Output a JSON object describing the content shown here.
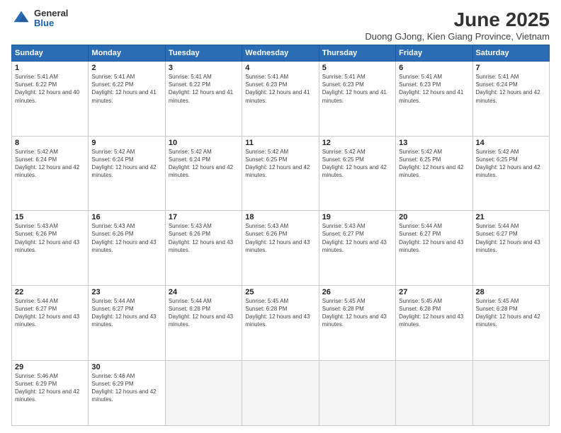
{
  "logo": {
    "general": "General",
    "blue": "Blue"
  },
  "header": {
    "title": "June 2025",
    "subtitle": "Duong GJong, Kien Giang Province, Vietnam"
  },
  "weekdays": [
    "Sunday",
    "Monday",
    "Tuesday",
    "Wednesday",
    "Thursday",
    "Friday",
    "Saturday"
  ],
  "weeks": [
    [
      {
        "day": "1",
        "info": "Sunrise: 5:41 AM\nSunset: 6:22 PM\nDaylight: 12 hours and 40 minutes."
      },
      {
        "day": "2",
        "info": "Sunrise: 5:41 AM\nSunset: 6:22 PM\nDaylight: 12 hours and 41 minutes."
      },
      {
        "day": "3",
        "info": "Sunrise: 5:41 AM\nSunset: 6:22 PM\nDaylight: 12 hours and 41 minutes."
      },
      {
        "day": "4",
        "info": "Sunrise: 5:41 AM\nSunset: 6:23 PM\nDaylight: 12 hours and 41 minutes."
      },
      {
        "day": "5",
        "info": "Sunrise: 5:41 AM\nSunset: 6:23 PM\nDaylight: 12 hours and 41 minutes."
      },
      {
        "day": "6",
        "info": "Sunrise: 5:41 AM\nSunset: 6:23 PM\nDaylight: 12 hours and 41 minutes."
      },
      {
        "day": "7",
        "info": "Sunrise: 5:41 AM\nSunset: 6:24 PM\nDaylight: 12 hours and 42 minutes."
      }
    ],
    [
      {
        "day": "8",
        "info": "Sunrise: 5:42 AM\nSunset: 6:24 PM\nDaylight: 12 hours and 42 minutes."
      },
      {
        "day": "9",
        "info": "Sunrise: 5:42 AM\nSunset: 6:24 PM\nDaylight: 12 hours and 42 minutes."
      },
      {
        "day": "10",
        "info": "Sunrise: 5:42 AM\nSunset: 6:24 PM\nDaylight: 12 hours and 42 minutes."
      },
      {
        "day": "11",
        "info": "Sunrise: 5:42 AM\nSunset: 6:25 PM\nDaylight: 12 hours and 42 minutes."
      },
      {
        "day": "12",
        "info": "Sunrise: 5:42 AM\nSunset: 6:25 PM\nDaylight: 12 hours and 42 minutes."
      },
      {
        "day": "13",
        "info": "Sunrise: 5:42 AM\nSunset: 6:25 PM\nDaylight: 12 hours and 42 minutes."
      },
      {
        "day": "14",
        "info": "Sunrise: 5:42 AM\nSunset: 6:25 PM\nDaylight: 12 hours and 42 minutes."
      }
    ],
    [
      {
        "day": "15",
        "info": "Sunrise: 5:43 AM\nSunset: 6:26 PM\nDaylight: 12 hours and 43 minutes."
      },
      {
        "day": "16",
        "info": "Sunrise: 5:43 AM\nSunset: 6:26 PM\nDaylight: 12 hours and 43 minutes."
      },
      {
        "day": "17",
        "info": "Sunrise: 5:43 AM\nSunset: 6:26 PM\nDaylight: 12 hours and 43 minutes."
      },
      {
        "day": "18",
        "info": "Sunrise: 5:43 AM\nSunset: 6:26 PM\nDaylight: 12 hours and 43 minutes."
      },
      {
        "day": "19",
        "info": "Sunrise: 5:43 AM\nSunset: 6:27 PM\nDaylight: 12 hours and 43 minutes."
      },
      {
        "day": "20",
        "info": "Sunrise: 5:44 AM\nSunset: 6:27 PM\nDaylight: 12 hours and 43 minutes."
      },
      {
        "day": "21",
        "info": "Sunrise: 5:44 AM\nSunset: 6:27 PM\nDaylight: 12 hours and 43 minutes."
      }
    ],
    [
      {
        "day": "22",
        "info": "Sunrise: 5:44 AM\nSunset: 6:27 PM\nDaylight: 12 hours and 43 minutes."
      },
      {
        "day": "23",
        "info": "Sunrise: 5:44 AM\nSunset: 6:27 PM\nDaylight: 12 hours and 43 minutes."
      },
      {
        "day": "24",
        "info": "Sunrise: 5:44 AM\nSunset: 6:28 PM\nDaylight: 12 hours and 43 minutes."
      },
      {
        "day": "25",
        "info": "Sunrise: 5:45 AM\nSunset: 6:28 PM\nDaylight: 12 hours and 43 minutes."
      },
      {
        "day": "26",
        "info": "Sunrise: 5:45 AM\nSunset: 6:28 PM\nDaylight: 12 hours and 43 minutes."
      },
      {
        "day": "27",
        "info": "Sunrise: 5:45 AM\nSunset: 6:28 PM\nDaylight: 12 hours and 43 minutes."
      },
      {
        "day": "28",
        "info": "Sunrise: 5:45 AM\nSunset: 6:28 PM\nDaylight: 12 hours and 42 minutes."
      }
    ],
    [
      {
        "day": "29",
        "info": "Sunrise: 5:46 AM\nSunset: 6:29 PM\nDaylight: 12 hours and 42 minutes."
      },
      {
        "day": "30",
        "info": "Sunrise: 5:46 AM\nSunset: 6:29 PM\nDaylight: 12 hours and 42 minutes."
      },
      null,
      null,
      null,
      null,
      null
    ]
  ]
}
